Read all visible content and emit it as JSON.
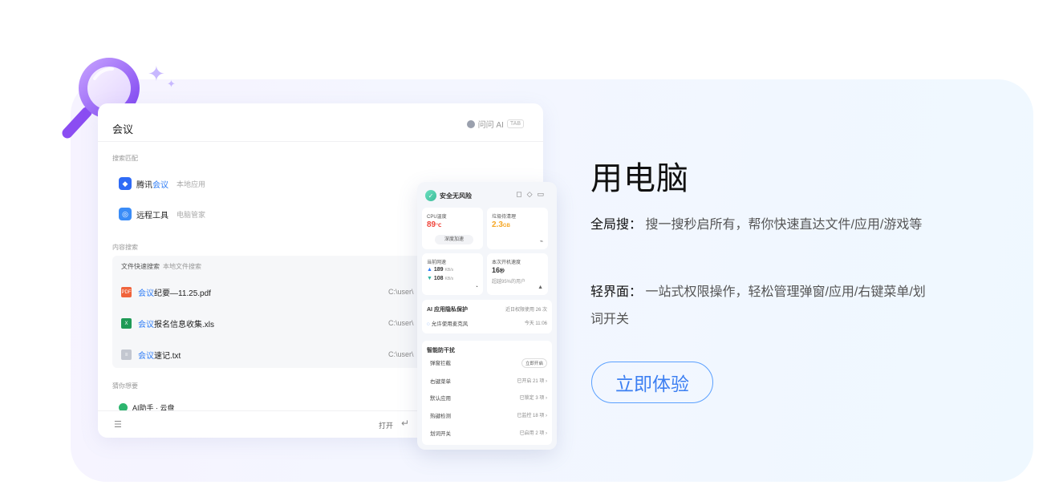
{
  "search_window": {
    "query": "会议",
    "ai_label": "问问 AI",
    "ai_key": "TAB",
    "section_match": "搜索匹配",
    "apps": [
      {
        "name_hl": "腾讯",
        "name_rest": "会议",
        "sub": "本地应用",
        "icon": "tencent-meeting-icon",
        "color": "#2f6bf6"
      },
      {
        "name_hl": "",
        "name_rest": "远程工具",
        "sub": "电脑管家",
        "icon": "remote-tool-icon",
        "color": "#3a8cf7"
      }
    ],
    "section_content": "内容搜索",
    "file_block_title": "文件快速搜索",
    "file_block_sub": "本地文件搜索",
    "files": [
      {
        "hl": "会议",
        "rest": "纪要—11.25.pdf",
        "path": "C:\\user\\",
        "icon": "pdf-file-icon",
        "color": "#f0643c"
      },
      {
        "hl": "会议",
        "rest": "报名信息收集.xls",
        "path": "C:\\user\\",
        "icon": "excel-file-icon",
        "color": "#1f9a56"
      },
      {
        "hl": "会议",
        "rest": "速记.txt",
        "path": "C:\\user\\",
        "icon": "txt-file-icon",
        "color": "#b8bcc6"
      }
    ],
    "section_guess": "猜你想要",
    "guess_item": "AI助手 · 云盘",
    "open_label": "打开"
  },
  "security_panel": {
    "status": "安全无风险",
    "cpu_label": "CPU温度",
    "cpu_value": "89",
    "cpu_unit": "℃",
    "cpu_button": "深度加速",
    "junk_label": "垃圾待清理",
    "junk_value": "2.3",
    "junk_unit": "GB",
    "net_label": "当前网速",
    "net_up": "189",
    "net_down": "108",
    "net_unit": "KB/s",
    "boot_label": "本次开机速度",
    "boot_value": "16",
    "boot_unit": "秒",
    "boot_sub": "超越95%的用户",
    "ai_privacy_title": "AI 应用隐私保护",
    "ai_privacy_right": "近日权限使用 26 次",
    "ai_privacy_row": "允许使用麦克风",
    "ai_privacy_time": "今天 11:06",
    "anti_title": "智能防干扰",
    "anti_rows": [
      {
        "label": "弹窗拦截",
        "right": "立即开启",
        "pill": true
      },
      {
        "label": "右键菜单",
        "right": "已开启 21 项 ›",
        "pill": false
      },
      {
        "label": "默认应用",
        "right": "已锁定 3 项 ›",
        "pill": false
      },
      {
        "label": "热键检测",
        "right": "已监控 18 项 ›",
        "pill": false
      },
      {
        "label": "划词开关",
        "right": "已启用 2 项 ›",
        "pill": false
      }
    ]
  },
  "content": {
    "headline": "用电脑",
    "features": [
      {
        "key": "全局搜：",
        "text": " 搜一搜秒启所有，帮你快速直达文件/应用/游戏等"
      },
      {
        "key": "轻界面：",
        "text": " 一站式权限操作，轻松管理弹窗/应用/右键菜单/划词开关"
      }
    ],
    "cta": "立即体验"
  },
  "colors": {
    "accent": "#3c7ff2",
    "highlight": "#2f7df6",
    "cpu_red": "#f0443a",
    "junk_orange": "#f5a623"
  }
}
